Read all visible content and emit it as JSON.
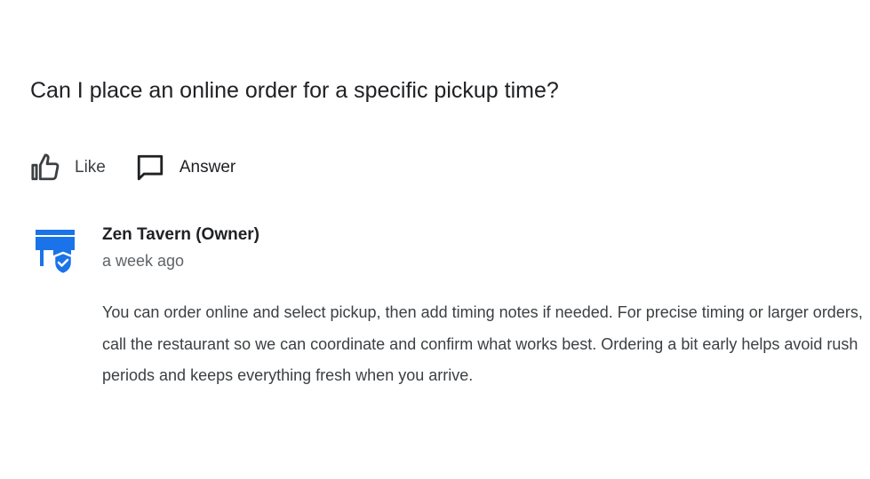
{
  "question": {
    "text": "Can I place an online order for a specific pickup time?"
  },
  "actions": {
    "like_label": "Like",
    "like_icon": "thumbs-up-icon",
    "answer_label": "Answer",
    "answer_icon": "comment-icon"
  },
  "reply": {
    "author": "Zen Tavern (Owner)",
    "time": "a week ago",
    "avatar_icon": "verified-store-icon",
    "text": "You can order online and select pickup, then add timing notes if needed. For precise timing or larger orders, call the restaurant so we can coordinate and confirm what works best. Ordering a bit early helps avoid rush periods and keeps everything fresh when you arrive."
  },
  "colors": {
    "brand_blue": "#1a73e8",
    "text_primary": "#202124",
    "text_secondary": "#5f6368"
  }
}
